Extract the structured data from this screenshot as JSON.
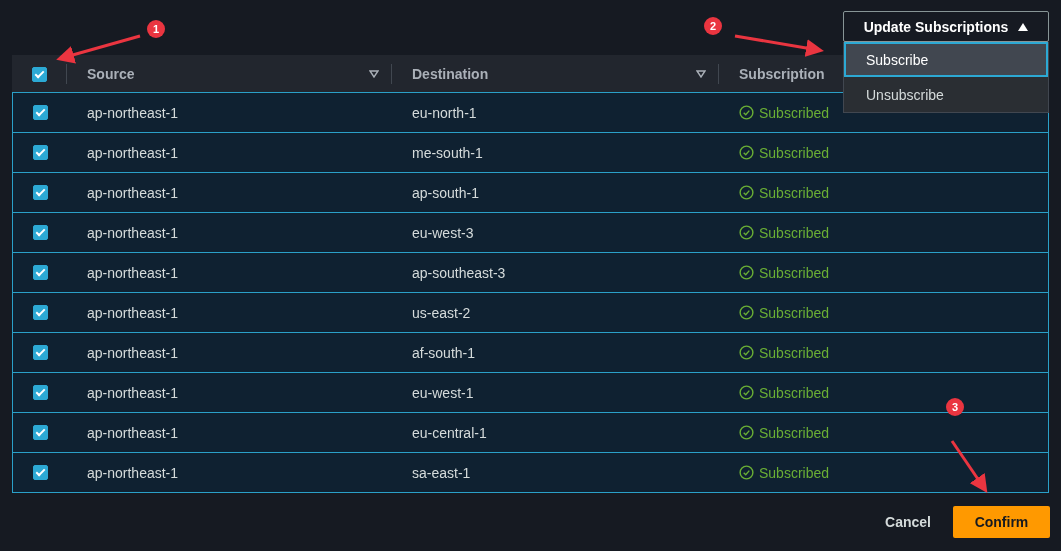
{
  "table": {
    "select_all": {
      "checked": true
    },
    "columns": [
      {
        "label": "Source",
        "filter": true
      },
      {
        "label": "Destination",
        "filter": true
      },
      {
        "label": "Subscription",
        "filter": false
      }
    ],
    "rows": [
      {
        "selected": true,
        "source": "ap-northeast-1",
        "destination": "eu-north-1",
        "subscription": "Subscribed"
      },
      {
        "selected": true,
        "source": "ap-northeast-1",
        "destination": "me-south-1",
        "subscription": "Subscribed"
      },
      {
        "selected": true,
        "source": "ap-northeast-1",
        "destination": "ap-south-1",
        "subscription": "Subscribed"
      },
      {
        "selected": true,
        "source": "ap-northeast-1",
        "destination": "eu-west-3",
        "subscription": "Subscribed"
      },
      {
        "selected": true,
        "source": "ap-northeast-1",
        "destination": "ap-southeast-3",
        "subscription": "Subscribed"
      },
      {
        "selected": true,
        "source": "ap-northeast-1",
        "destination": "us-east-2",
        "subscription": "Subscribed"
      },
      {
        "selected": true,
        "source": "ap-northeast-1",
        "destination": "af-south-1",
        "subscription": "Subscribed"
      },
      {
        "selected": true,
        "source": "ap-northeast-1",
        "destination": "eu-west-1",
        "subscription": "Subscribed"
      },
      {
        "selected": true,
        "source": "ap-northeast-1",
        "destination": "eu-central-1",
        "subscription": "Subscribed"
      },
      {
        "selected": true,
        "source": "ap-northeast-1",
        "destination": "sa-east-1",
        "subscription": "Subscribed"
      }
    ]
  },
  "dropdown": {
    "label": "Update Subscriptions",
    "expanded": true,
    "items": [
      {
        "label": "Subscribe",
        "selected": true
      },
      {
        "label": "Unsubscribe",
        "selected": false
      }
    ]
  },
  "footer": {
    "buttons": [
      {
        "label": "Cancel",
        "kind": "link"
      },
      {
        "label": "Confirm",
        "kind": "primary"
      }
    ]
  },
  "annotations": [
    {
      "number": "1"
    },
    {
      "number": "2"
    },
    {
      "number": "3"
    }
  ]
}
